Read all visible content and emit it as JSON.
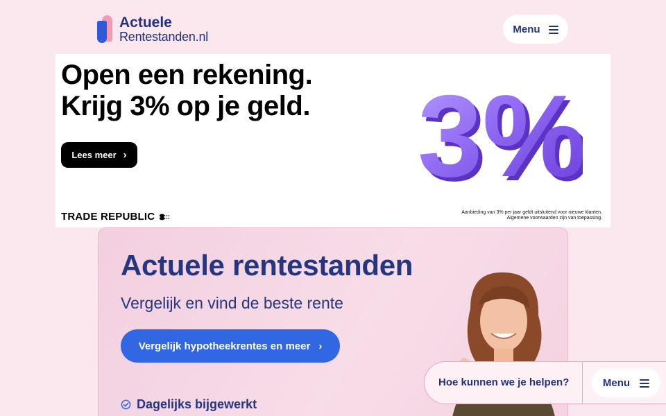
{
  "header": {
    "logo_line1": "Actuele",
    "logo_line2": "Rentestanden.nl",
    "menu_label": "Menu"
  },
  "ad": {
    "headline_line1": "Open een rekening.",
    "headline_line2": "Krijg 3% op je geld.",
    "cta_label": "Lees meer",
    "graphic_text": "3%",
    "brand": "TRADE REPUBLIC",
    "disclaimer_line1": "Aanbieding van 3% per jaar geldt uitsluitend voor nieuwe klanten.",
    "disclaimer_line2": "Algemene voorwaarden zijn van toepassing."
  },
  "hero": {
    "title": "Actuele rentestanden",
    "subtitle": "Vergelijk en vind de beste rente",
    "cta_label": "Vergelijk hypotheekrentes en meer",
    "feature_label": "Dagelijks bijgewerkt"
  },
  "chat": {
    "prompt": "Hoe kunnen we je helpen?",
    "menu_label": "Menu"
  },
  "colors": {
    "background": "#fbe8ef",
    "brand_navy": "#23307a",
    "brand_blue": "#3167e3",
    "brand_pink": "#f39ab5",
    "ad_purple": "#8b63f0"
  },
  "icons": [
    "logo-mark",
    "hamburger-icon",
    "chevron-right-icon",
    "flag-icon",
    "check-circle-icon"
  ]
}
